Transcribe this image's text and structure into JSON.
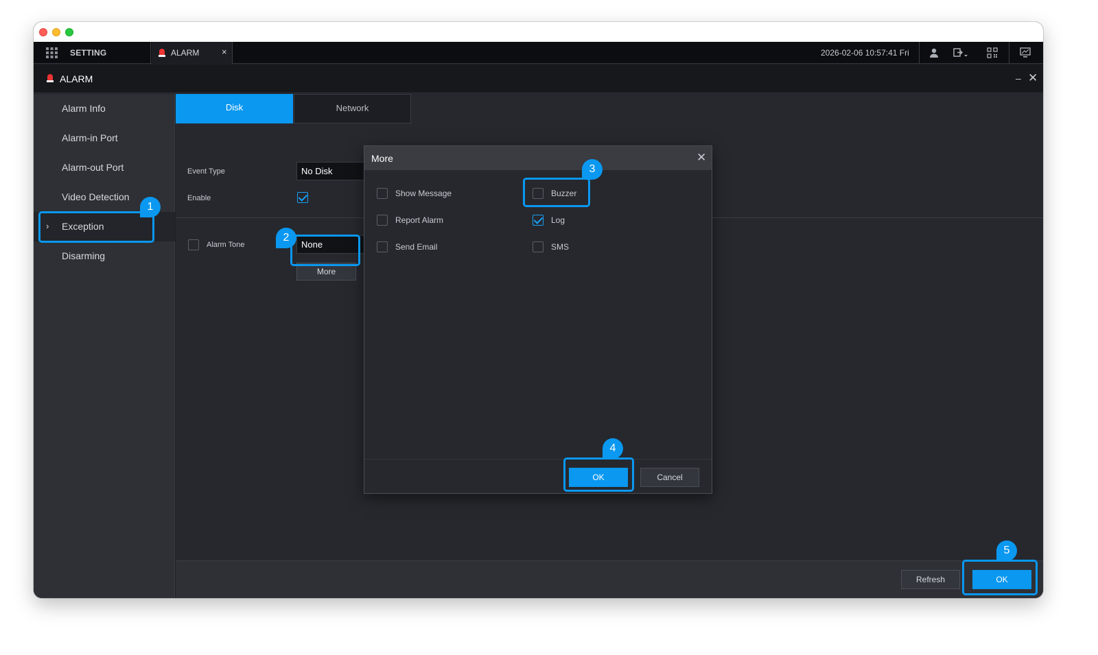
{
  "topbar": {
    "setting_tab": "SETTING",
    "alarm_tab": "ALARM",
    "alarm_tab_close": "×",
    "datetime": "2026-02-06 10:57:41 Fri"
  },
  "panel": {
    "title": "ALARM",
    "minimize": "–",
    "close": "✕"
  },
  "sidebar": {
    "items": [
      {
        "label": "Alarm Info"
      },
      {
        "label": "Alarm-in Port"
      },
      {
        "label": "Alarm-out Port"
      },
      {
        "label": "Video Detection"
      },
      {
        "label": "Exception"
      },
      {
        "label": "Disarming"
      }
    ],
    "active_chevron": "›"
  },
  "content": {
    "tabs": [
      {
        "label": "Disk"
      },
      {
        "label": "Network"
      }
    ],
    "event_type_label": "Event Type",
    "event_type_value": "No Disk",
    "enable_label": "Enable",
    "enable_checked": true,
    "alarm_tone_label": "Alarm Tone",
    "alarm_tone_checked": false,
    "alarm_tone_value": "None",
    "more_button": "More"
  },
  "footer": {
    "refresh_button": "Refresh",
    "ok_button": "OK"
  },
  "modal": {
    "title": "More",
    "close": "✕",
    "options": [
      {
        "label": "Show Message",
        "checked": false
      },
      {
        "label": "Buzzer",
        "checked": false
      },
      {
        "label": "Report Alarm",
        "checked": false
      },
      {
        "label": "Log",
        "checked": true
      },
      {
        "label": "Send Email",
        "checked": false
      },
      {
        "label": "SMS",
        "checked": false
      }
    ],
    "ok_button": "OK",
    "cancel_button": "Cancel"
  },
  "callouts": [
    "1",
    "2",
    "3",
    "4",
    "5"
  ],
  "colors": {
    "accent": "#0a98f0",
    "background": "#26282e",
    "sidebar": "#2e3036"
  }
}
